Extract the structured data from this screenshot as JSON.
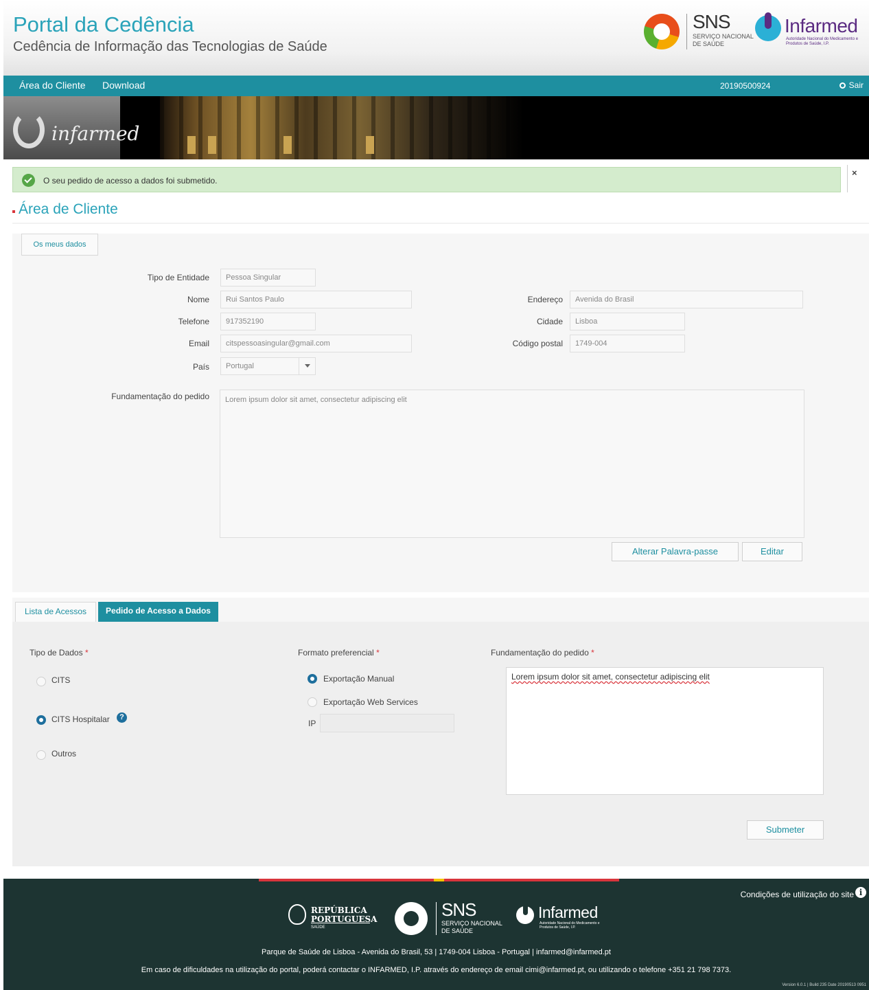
{
  "header": {
    "title": "Portal da Cedência",
    "subtitle": "Cedência de Informação das Tecnologias de Saúde",
    "sns_logo_text": "SNS",
    "sns_logo_sub": "SERVIÇO NACIONAL DE SAÚDE",
    "infarmed_logo_text": "Infarmed",
    "infarmed_logo_sub": "Autoridade Nacional do Medicamento e Produtos de Saúde, I.P."
  },
  "nav": {
    "items": [
      "Área do Cliente",
      "Download"
    ],
    "user_id": "20190500924",
    "exit_label": "Sair"
  },
  "banner": {
    "wall_text": "infarmed"
  },
  "alert": {
    "message": "O seu pedido de acesso a dados foi submetido.",
    "close": "×"
  },
  "section_title": "Área de Cliente",
  "profile": {
    "tab_label": "Os meus dados",
    "fields": {
      "tipo_entidade": {
        "label": "Tipo de Entidade",
        "value": "Pessoa Singular"
      },
      "nome": {
        "label": "Nome",
        "value": "Rui Santos Paulo"
      },
      "telefone": {
        "label": "Telefone",
        "value": "917352190"
      },
      "email": {
        "label": "Email",
        "value": "citspessoasingular@gmail.com"
      },
      "pais": {
        "label": "País",
        "value": "Portugal"
      },
      "endereco": {
        "label": "Endereço",
        "value": "Avenida do Brasil"
      },
      "cidade": {
        "label": "Cidade",
        "value": "Lisboa"
      },
      "codigo_postal": {
        "label": "Código postal",
        "value": "1749-004"
      },
      "fundamentacao": {
        "label": "Fundamentação do pedido",
        "value": "Lorem ipsum dolor sit amet, consectetur adipiscing elit"
      }
    },
    "buttons": {
      "change_password": "Alterar Palavra-passe",
      "edit": "Editar"
    }
  },
  "request": {
    "tabs": [
      "Lista de Acessos",
      "Pedido de Acesso a Dados"
    ],
    "active_tab": "Pedido de Acesso a Dados",
    "tipo_dados": {
      "label": "Tipo de Dados",
      "required_mark": "*",
      "options": [
        {
          "label": "CITS",
          "selected": false
        },
        {
          "label": "CITS Hospitalar",
          "selected": true
        },
        {
          "label": "Outros",
          "selected": false
        }
      ],
      "help_icon": "?"
    },
    "formato": {
      "label": "Formato preferencial",
      "required_mark": "*",
      "options": [
        {
          "label": "Exportação Manual",
          "selected": true
        },
        {
          "label": "Exportação Web Services",
          "selected": false
        }
      ],
      "ip_label": "IP",
      "ip_value": ""
    },
    "fundamentacao": {
      "label": "Fundamentação do pedido",
      "required_mark": "*",
      "value": "Lorem ipsum dolor sit amet, consectetur adipiscing elit"
    },
    "submit_label": "Submeter"
  },
  "footer": {
    "terms": "Condições de utilização do site",
    "info_icon": "i",
    "republica": "REPÚBLICA PORTUGUESA",
    "republica_sub": "SAÚDE",
    "sns": "SNS",
    "sns_sub": "SERVIÇO NACIONAL DE SAÚDE",
    "infarmed": "Infarmed",
    "infarmed_sub": "Autoridade Nacional do Medicamento e Produtos de Saúde, I.P.",
    "address": "Parque de Saúde de Lisboa - Avenida do Brasil, 53 | 1749-004 Lisboa - Portugal | infarmed@infarmed.pt",
    "contact": "Em caso de dificuldades na utilização do portal, poderá contactar o INFARMED, I.P. através do endereço de email cimi@infarmed.pt, ou utilizando o telefone +351 21 798 7373.",
    "version": "Version 6.0.1 | Build 235 Date 20190513 0951"
  },
  "colors": {
    "teal": "#1e8fa0",
    "title_blue": "#2aa3b9",
    "success_bg": "#d4eccd",
    "footer_bg": "#1d3432",
    "radio_selected": "#1e6f9d",
    "required": "#d9353c"
  }
}
